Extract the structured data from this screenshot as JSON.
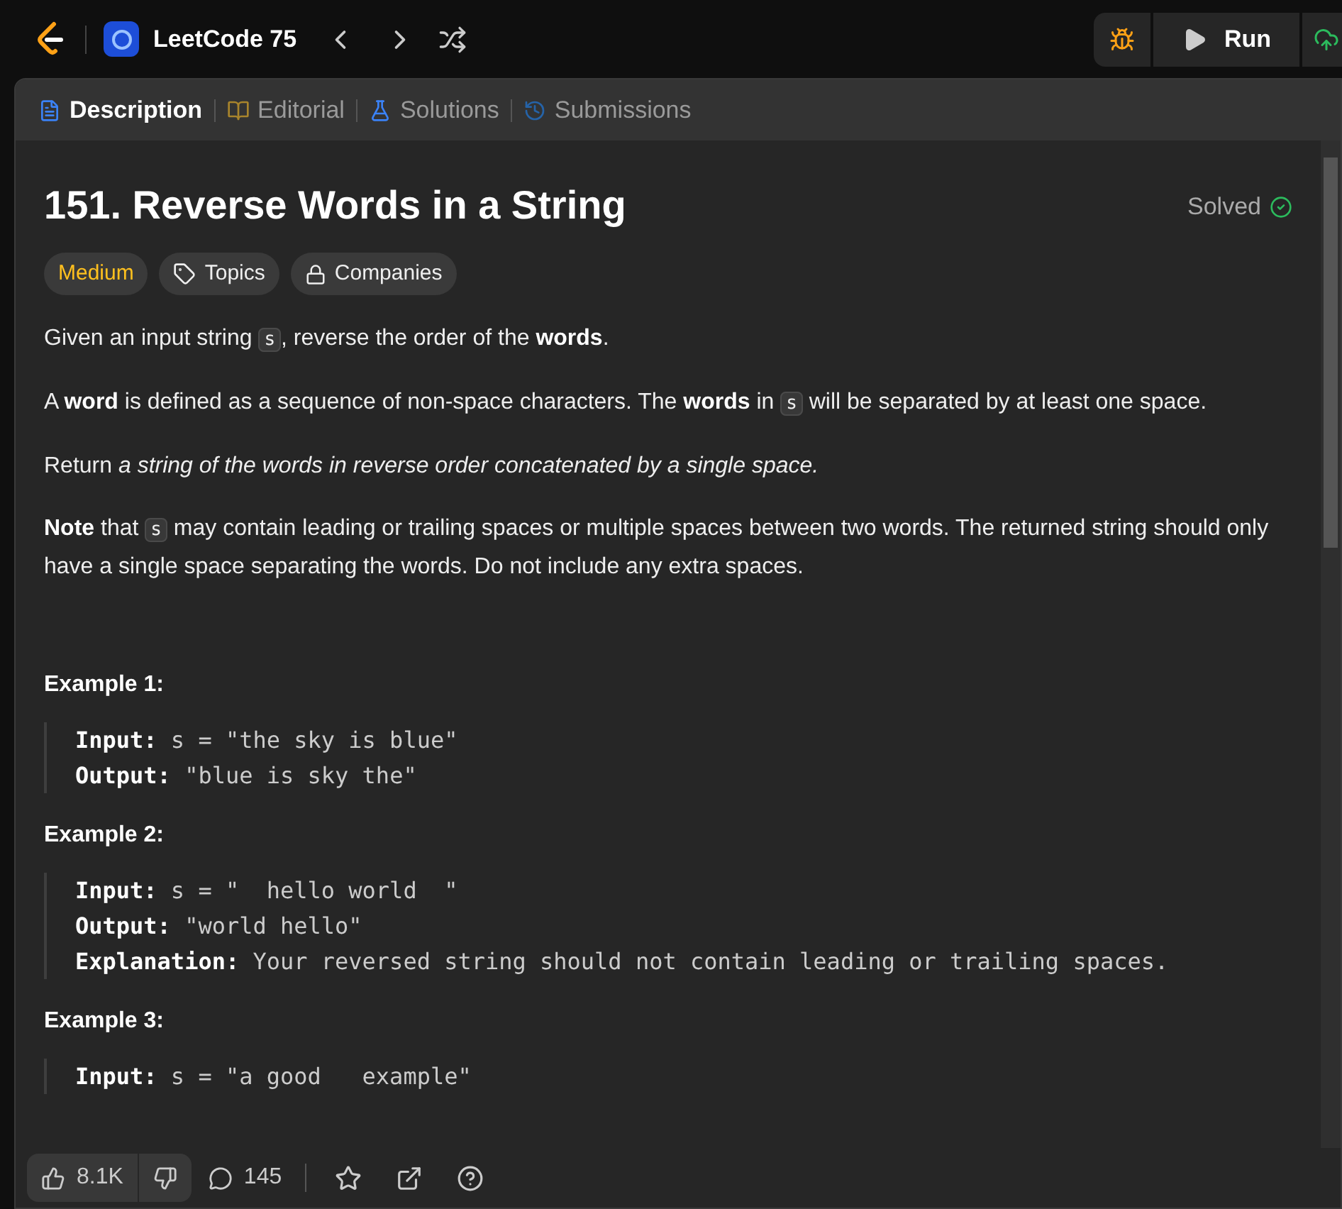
{
  "topbar": {
    "title": "LeetCode 75",
    "run_label": "Run"
  },
  "tabs": [
    {
      "label": "Description",
      "selected": true,
      "kind": "description"
    },
    {
      "label": "Editorial",
      "selected": false,
      "kind": "editorial"
    },
    {
      "label": "Solutions",
      "selected": false,
      "kind": "solutions"
    },
    {
      "label": "Submissions",
      "selected": false,
      "kind": "submissions"
    }
  ],
  "problem": {
    "title": "151. Reverse Words in a String",
    "status": "Solved",
    "solved": true,
    "tags": [
      {
        "label": "Medium",
        "kind": "difficulty"
      },
      {
        "label": "Topics",
        "kind": "topics"
      },
      {
        "label": "Companies",
        "kind": "companies"
      }
    ],
    "paragraphs": [
      [
        {
          "kind": "plain",
          "text": "Given an input string "
        },
        {
          "kind": "code",
          "text": "s"
        },
        {
          "kind": "plain",
          "text": ", reverse the order of the "
        },
        {
          "kind": "bold",
          "text": "words"
        },
        {
          "kind": "plain",
          "text": "."
        }
      ],
      [
        {
          "kind": "plain",
          "text": "A "
        },
        {
          "kind": "bold",
          "text": "word"
        },
        {
          "kind": "plain",
          "text": " is defined as a sequence of non-space characters. The "
        },
        {
          "kind": "bold",
          "text": "words"
        },
        {
          "kind": "plain",
          "text": " in "
        },
        {
          "kind": "code",
          "text": "s"
        },
        {
          "kind": "plain",
          "text": " will be separated by at least one space."
        }
      ],
      [
        {
          "kind": "plain",
          "text": "Return "
        },
        {
          "kind": "italic",
          "text": "a string of the words in reverse order concatenated by a single space."
        }
      ],
      [
        {
          "kind": "bold",
          "text": "Note"
        },
        {
          "kind": "plain",
          "text": " that "
        },
        {
          "kind": "code",
          "text": "s"
        },
        {
          "kind": "plain",
          "text": " may contain leading or trailing spaces or multiple spaces between two words. The returned string should only have a single space separating the words. Do not include any extra spaces."
        }
      ]
    ],
    "examples": [
      {
        "title": "Example 1:",
        "lines": [
          {
            "key": "Input:",
            "value": " s = \"the sky is blue\""
          },
          {
            "key": "Output:",
            "value": " \"blue is sky the\""
          }
        ]
      },
      {
        "title": "Example 2:",
        "lines": [
          {
            "key": "Input:",
            "value": " s = \"  hello world  \""
          },
          {
            "key": "Output:",
            "value": " \"world hello\""
          },
          {
            "key": "Explanation:",
            "value": " Your reversed string should not contain leading or trailing spaces."
          }
        ]
      },
      {
        "title": "Example 3:",
        "lines": [
          {
            "key": "Input:",
            "value": " s = \"a good   example\""
          }
        ]
      }
    ]
  },
  "footer": {
    "likes": "8.1K",
    "comments": "145"
  }
}
